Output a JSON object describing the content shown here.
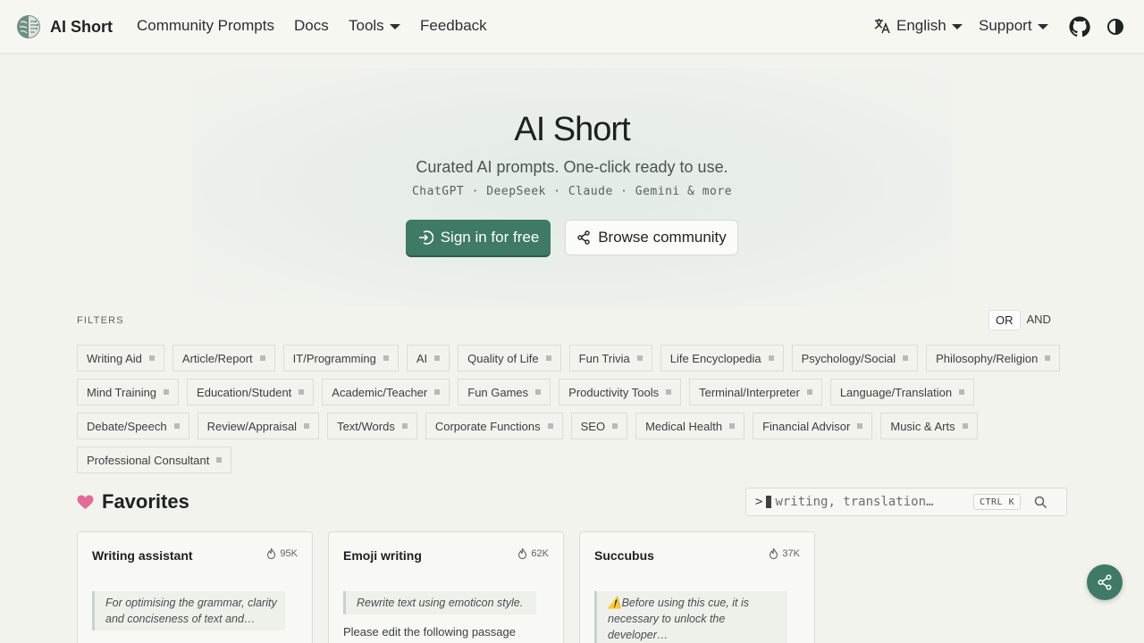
{
  "navbar": {
    "brand": "AI Short",
    "links": [
      "Community Prompts",
      "Docs",
      "Tools",
      "Feedback"
    ],
    "language": "English",
    "support": "Support"
  },
  "hero": {
    "title": "AI Short",
    "subtitle": "Curated AI prompts. One-click ready to use.",
    "models": "ChatGPT · DeepSeek · Claude · Gemini & more",
    "primary_button": "Sign in for free",
    "secondary_button": "Browse community"
  },
  "filters": {
    "label": "FILTERS",
    "logic_or": "OR",
    "logic_and": "AND",
    "rows": [
      [
        "Writing Aid",
        "Article/Report",
        "IT/Programming",
        "AI",
        "Quality of Life",
        "Fun Trivia",
        "Life Encyclopedia",
        "Psychology/Social",
        "Philosophy/Religion"
      ],
      [
        "Mind Training",
        "Education/Student",
        "Academic/Teacher",
        "Fun Games",
        "Productivity Tools",
        "Terminal/Interpreter",
        "Language/Translation"
      ],
      [
        "Debate/Speech",
        "Review/Appraisal",
        "Text/Words",
        "Corporate Functions",
        "SEO",
        "Medical Health",
        "Financial Advisor",
        "Music & Arts"
      ],
      [
        "Professional Consultant"
      ]
    ]
  },
  "favorites": {
    "title": "Favorites",
    "search_prompt": ">",
    "search_placeholder": "writing, translation…",
    "shortcut": "CTRL K",
    "cards": [
      {
        "title": "Writing assistant",
        "count": "95K",
        "quote": "For optimising the grammar, clarity and conciseness of text and…",
        "body": ""
      },
      {
        "title": "Emoji writing",
        "count": "62K",
        "quote": "Rewrite text using emoticon style.",
        "body": "Please edit the following passage"
      },
      {
        "title": "Succubus",
        "count": "37K",
        "quote": "⚠️Before using this cue, it is necessary to unlock the developer…",
        "body": ""
      }
    ]
  },
  "colors": {
    "accent": "#3e7a65",
    "background": "#f3f3ee",
    "heart": "#e46a9a"
  }
}
